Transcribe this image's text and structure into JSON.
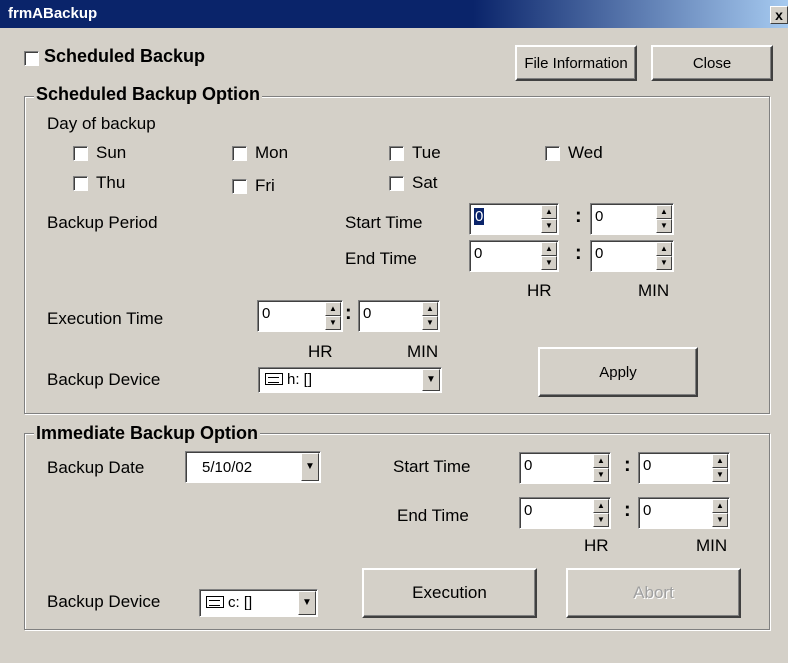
{
  "window": {
    "title": "frmABackup",
    "close_glyph": "x"
  },
  "top": {
    "scheduled_backup_label": "Scheduled Backup",
    "file_info_label": "File Information",
    "close_label": "Close"
  },
  "scheduled": {
    "group_title": "Scheduled Backup Option",
    "day_label": "Day of backup",
    "days": [
      "Sun",
      "Mon",
      "Tue",
      "Wed",
      "Thu",
      "Fri",
      "Sat"
    ],
    "backup_period_label": "Backup Period",
    "start_time_label": "Start Time",
    "end_time_label": "End Time",
    "start_hr": "0",
    "start_min": "0",
    "end_hr": "0",
    "end_min": "0",
    "hr_label": "HR",
    "min_label": "MIN",
    "execution_time_label": "Execution Time",
    "exec_hr": "0",
    "exec_min": "0",
    "exec_hr_label": "HR",
    "exec_min_label": "MIN",
    "backup_device_label": "Backup  Device",
    "device_value": "h: []",
    "apply_label": "Apply"
  },
  "immediate": {
    "group_title": "Immediate Backup Option",
    "backup_date_label": "Backup Date",
    "backup_date_value": "5/10/02",
    "start_time_label": "Start Time",
    "end_time_label": "End Time",
    "start_hr": "0",
    "start_min": "0",
    "end_hr": "0",
    "end_min": "0",
    "hr_label": "HR",
    "min_label": "MIN",
    "backup_device_label": "Backup Device",
    "device_value": "c: []",
    "execution_label": "Execution",
    "abort_label": "Abort"
  },
  "colon": ":",
  "icons": {
    "up": "▲",
    "down": "▼"
  }
}
